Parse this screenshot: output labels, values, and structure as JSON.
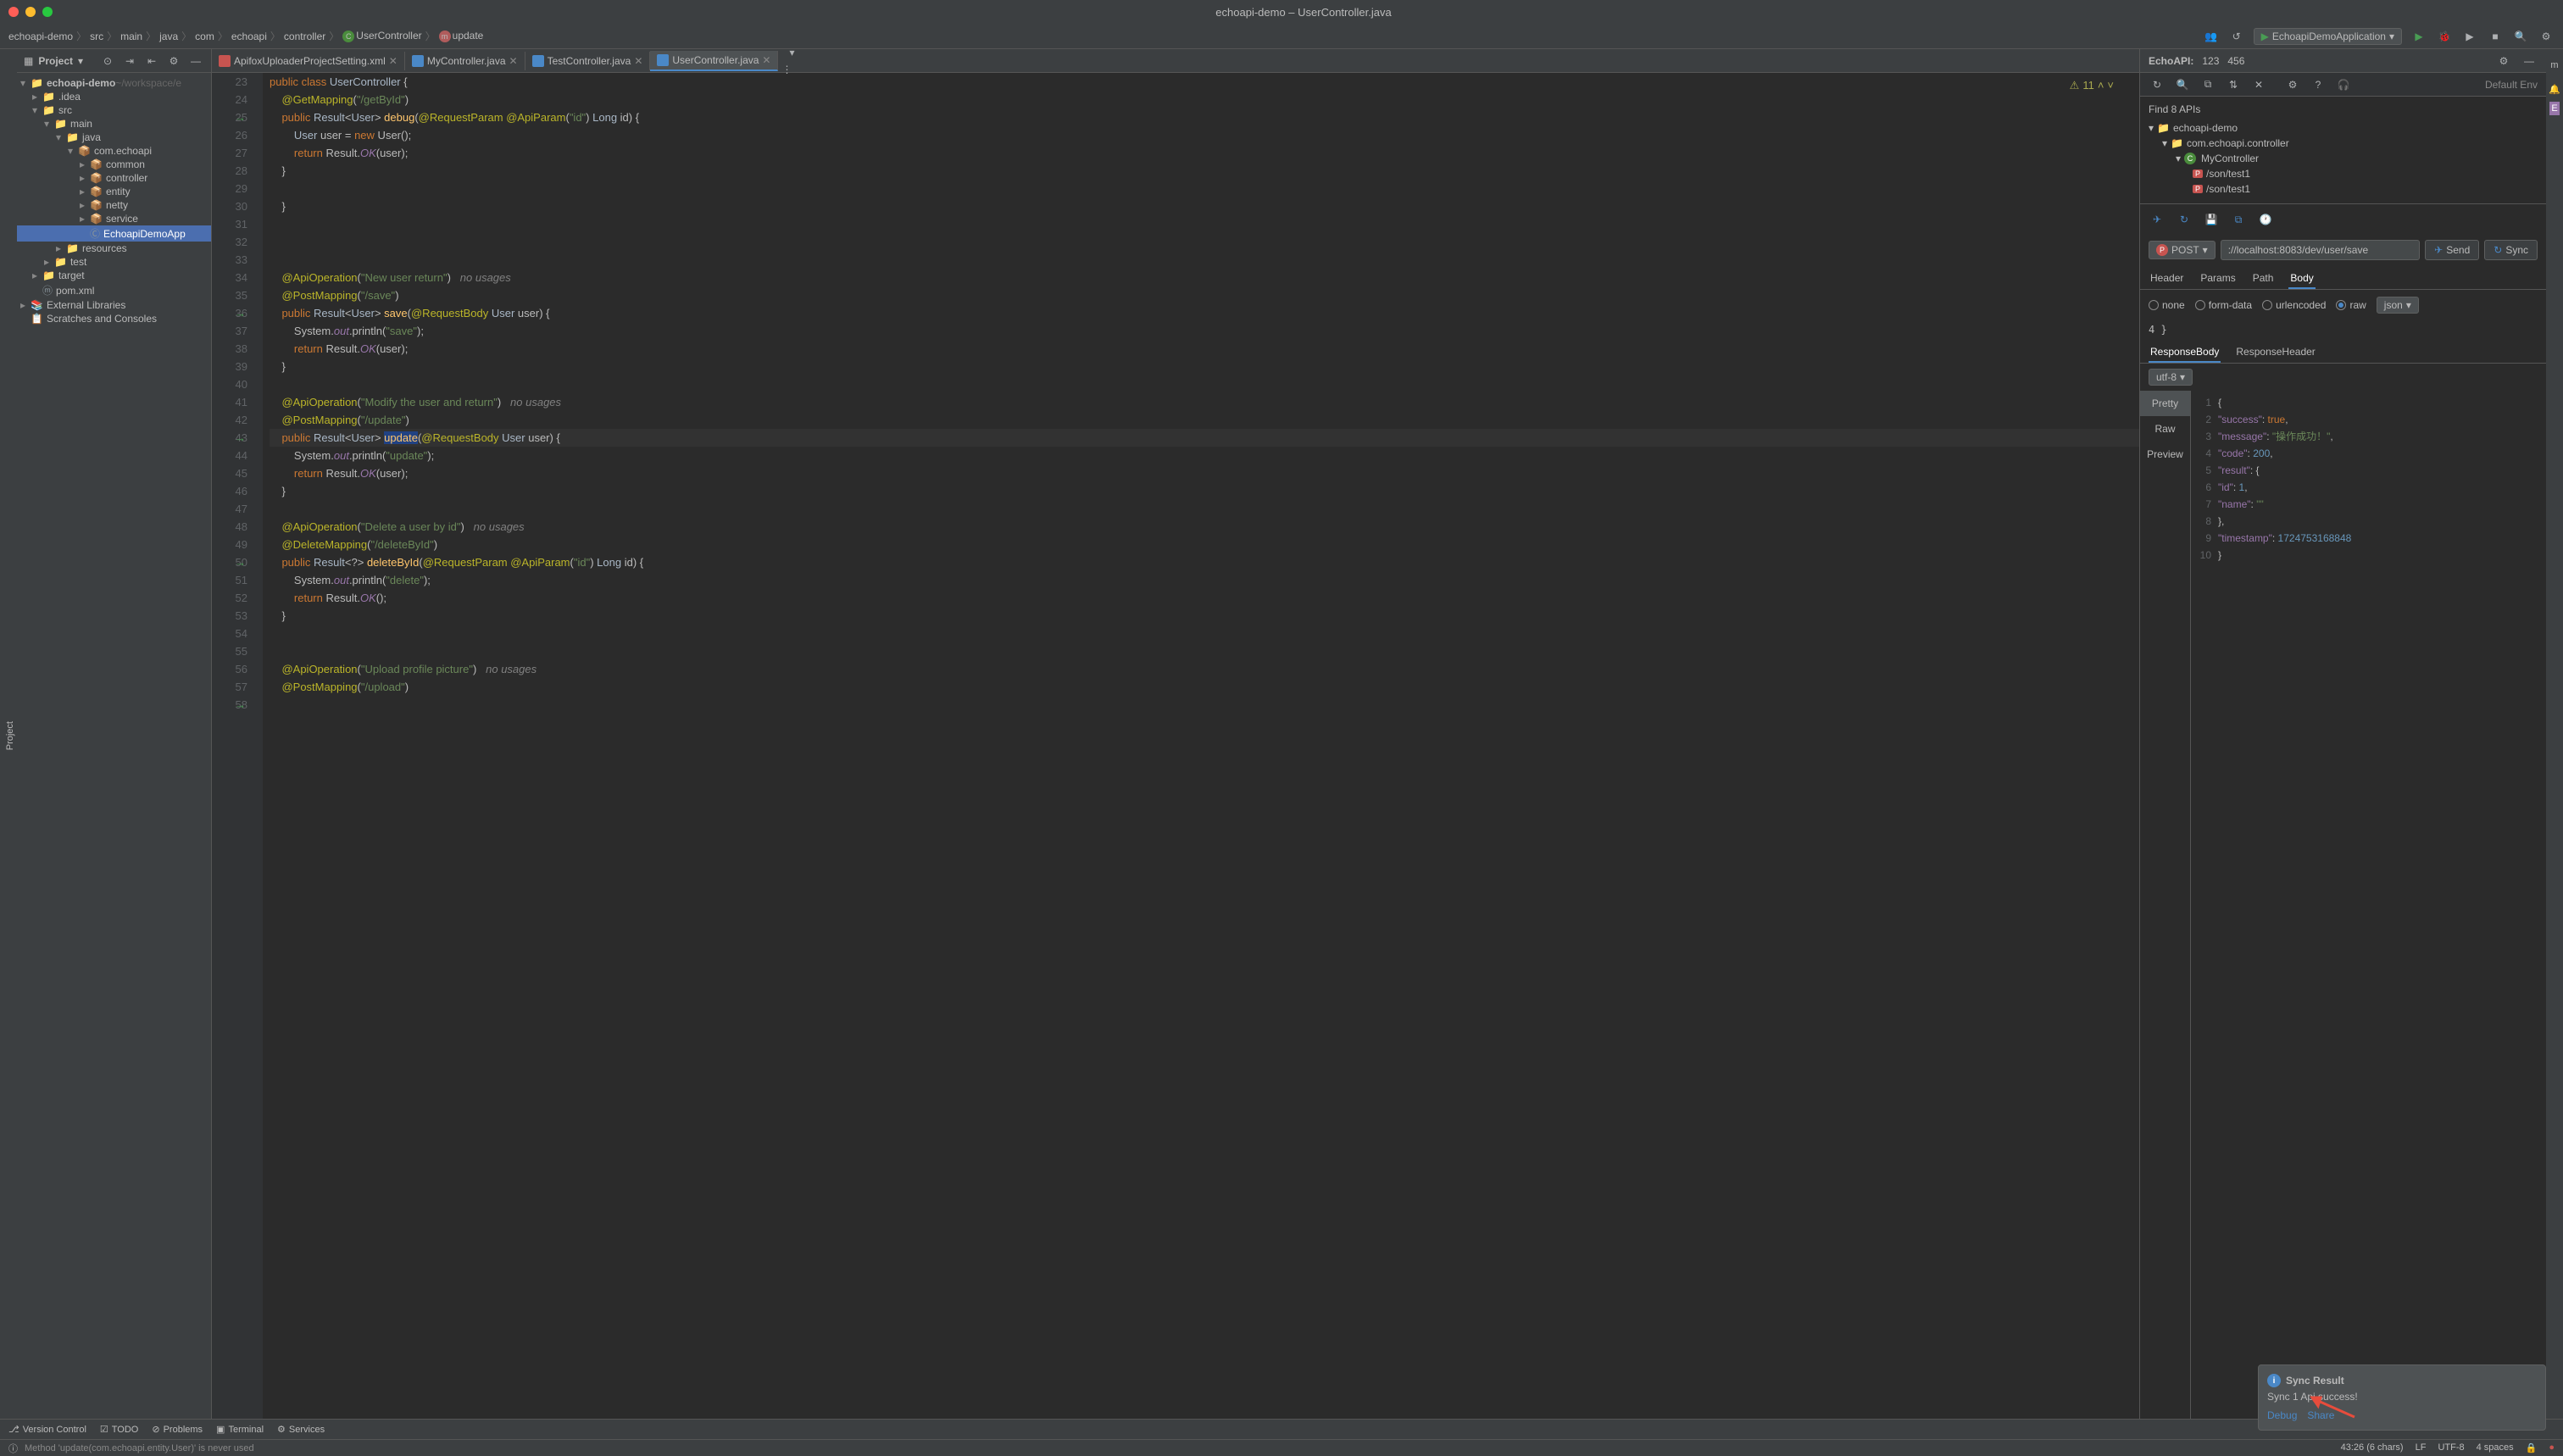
{
  "window": {
    "title": "echoapi-demo – UserController.java"
  },
  "breadcrumb": [
    "echoapi-demo",
    "src",
    "main",
    "java",
    "com",
    "echoapi",
    "controller",
    "UserController",
    "update"
  ],
  "runConfig": "EchoapiDemoApplication",
  "projectPanel": {
    "title": "Project",
    "rootName": "echoapi-demo",
    "rootPath": "~/workspace/e",
    "tree": [
      {
        "indent": 0,
        "arrow": "▾",
        "icon": "📁",
        "name": "echoapi-demo",
        "suffix": " ~/workspace/e",
        "bold": true
      },
      {
        "indent": 1,
        "arrow": "▸",
        "icon": "📁",
        "name": ".idea"
      },
      {
        "indent": 1,
        "arrow": "▾",
        "icon": "📁",
        "name": "src"
      },
      {
        "indent": 2,
        "arrow": "▾",
        "icon": "📁",
        "name": "main"
      },
      {
        "indent": 3,
        "arrow": "▾",
        "icon": "📁",
        "name": "java",
        "blue": true
      },
      {
        "indent": 4,
        "arrow": "▾",
        "icon": "📦",
        "name": "com.echoapi"
      },
      {
        "indent": 5,
        "arrow": "▸",
        "icon": "📦",
        "name": "common"
      },
      {
        "indent": 5,
        "arrow": "▸",
        "icon": "📦",
        "name": "controller"
      },
      {
        "indent": 5,
        "arrow": "▸",
        "icon": "📦",
        "name": "entity"
      },
      {
        "indent": 5,
        "arrow": "▸",
        "icon": "📦",
        "name": "netty"
      },
      {
        "indent": 5,
        "arrow": "▸",
        "icon": "📦",
        "name": "service"
      },
      {
        "indent": 5,
        "arrow": " ",
        "icon": "Ⓒ",
        "name": "EchoapiDemoApp",
        "selected": true
      },
      {
        "indent": 3,
        "arrow": "▸",
        "icon": "📁",
        "name": "resources"
      },
      {
        "indent": 2,
        "arrow": "▸",
        "icon": "📁",
        "name": "test"
      },
      {
        "indent": 1,
        "arrow": "▸",
        "icon": "📁",
        "name": "target"
      },
      {
        "indent": 1,
        "arrow": " ",
        "icon": "ⓜ",
        "name": "pom.xml"
      },
      {
        "indent": 0,
        "arrow": "▸",
        "icon": "📚",
        "name": "External Libraries"
      },
      {
        "indent": 0,
        "arrow": " ",
        "icon": "📋",
        "name": "Scratches and Consoles"
      }
    ]
  },
  "editorTabs": [
    {
      "name": "ApifoxUploaderProjectSetting.xml",
      "icon": "xml"
    },
    {
      "name": "MyController.java",
      "icon": "class"
    },
    {
      "name": "TestController.java",
      "icon": "class"
    },
    {
      "name": "UserController.java",
      "icon": "class",
      "active": true
    }
  ],
  "warningCount": "11",
  "code": {
    "lines": [
      {
        "n": 23,
        "html": "<span class='kw'>public class</span> <span class='type'>UserController</span> {"
      },
      {
        "n": 24,
        "html": "    <span class='anno'>@GetMapping</span>(<span class='str'>\"/getById\"</span>)"
      },
      {
        "n": 25,
        "marker": "→",
        "html": "    <span class='kw'>public</span> <span class='type'>Result</span>&lt;<span class='type'>User</span>&gt; <span class='method'>debug</span>(<span class='anno'>@RequestParam @ApiParam</span>(<span class='str'>\"id\"</span>) <span class='type'>Long</span> id) {"
      },
      {
        "n": 26,
        "html": "        <span class='type'>User</span> user = <span class='kw'>new</span> User();"
      },
      {
        "n": 27,
        "html": "        <span class='kw'>return</span> Result.<span class='field'>OK</span>(user);"
      },
      {
        "n": 28,
        "html": "    }"
      },
      {
        "n": 29,
        "html": ""
      },
      {
        "n": 30,
        "html": "    }"
      },
      {
        "n": 31,
        "html": ""
      },
      {
        "n": 32,
        "html": ""
      },
      {
        "n": 33,
        "html": ""
      },
      {
        "n": 34,
        "html": "    <span class='anno'>@ApiOperation</span>(<span class='str'>\"New user return\"</span>)   <span class='comment'>no usages</span>"
      },
      {
        "n": 35,
        "html": "    <span class='anno'>@PostMapping</span>(<span class='str'>\"/save\"</span>)"
      },
      {
        "n": 36,
        "marker": "→",
        "html": "    <span class='kw'>public</span> <span class='type'>Result</span>&lt;<span class='type'>User</span>&gt; <span class='method'>save</span>(<span class='anno'>@RequestBody</span> <span class='type'>User</span> user) {"
      },
      {
        "n": 37,
        "html": "        System.<span class='field'>out</span>.println(<span class='str'>\"save\"</span>);"
      },
      {
        "n": 38,
        "html": "        <span class='kw'>return</span> Result.<span class='field'>OK</span>(user);"
      },
      {
        "n": 39,
        "html": "    }"
      },
      {
        "n": 40,
        "html": ""
      },
      {
        "n": 41,
        "html": "    <span class='anno'>@ApiOperation</span>(<span class='str'>\"Modify the user and return\"</span>)   <span class='comment'>no usages</span>"
      },
      {
        "n": 42,
        "html": "    <span class='anno'>@PostMapping</span>(<span class='str'>\"/update\"</span>)"
      },
      {
        "n": 43,
        "marker": "→",
        "hl": true,
        "html": "    <span class='kw'>public</span> <span class='type'>Result</span>&lt;<span class='type'>User</span>&gt; <span class='method selected-text'>update</span>(<span class='anno'>@RequestBody</span> <span class='type'>User</span> user) {"
      },
      {
        "n": 44,
        "html": "        System.<span class='field'>out</span>.println(<span class='str'>\"update\"</span>);"
      },
      {
        "n": 45,
        "html": "        <span class='kw'>return</span> Result.<span class='field'>OK</span>(user);"
      },
      {
        "n": 46,
        "html": "    }"
      },
      {
        "n": 47,
        "html": ""
      },
      {
        "n": 48,
        "html": "    <span class='anno'>@ApiOperation</span>(<span class='str'>\"Delete a user by id\"</span>)   <span class='comment'>no usages</span>"
      },
      {
        "n": 49,
        "html": "    <span class='anno'>@DeleteMapping</span>(<span class='str'>\"/deleteById\"</span>)"
      },
      {
        "n": 50,
        "marker": "→",
        "html": "    <span class='kw'>public</span> <span class='type'>Result</span>&lt;?&gt; <span class='method'>deleteById</span>(<span class='anno'>@RequestParam @ApiParam</span>(<span class='str'>\"id\"</span>) <span class='type'>Long</span> id) {"
      },
      {
        "n": 51,
        "html": "        System.<span class='field'>out</span>.println(<span class='str'>\"delete\"</span>);"
      },
      {
        "n": 52,
        "html": "        <span class='kw'>return</span> Result.<span class='field'>OK</span>();"
      },
      {
        "n": 53,
        "html": "    }"
      },
      {
        "n": 54,
        "html": ""
      },
      {
        "n": 55,
        "html": ""
      },
      {
        "n": 56,
        "html": "    <span class='anno'>@ApiOperation</span>(<span class='str'>\"Upload profile picture\"</span>)   <span class='comment'>no usages</span>"
      },
      {
        "n": 57,
        "html": "    <span class='anno'>@PostMapping</span>(<span class='str'>\"/upload\"</span>)"
      },
      {
        "n": 58,
        "marker": "→",
        "html": ""
      }
    ]
  },
  "echoPanel": {
    "title": "EchoAPI:",
    "stat1": "123",
    "stat2": "456",
    "env": "Default Env",
    "apiTreeTitle": "Find 8 APIs",
    "apiTree": [
      {
        "indent": 0,
        "arrow": "▾",
        "name": "echoapi-demo"
      },
      {
        "indent": 1,
        "arrow": "▾",
        "name": "com.echoapi.controller"
      },
      {
        "indent": 2,
        "arrow": "▾",
        "name": "MyController",
        "icon": "C"
      },
      {
        "indent": 3,
        "arrow": " ",
        "name": "/son/test1",
        "badge": "P"
      },
      {
        "indent": 3,
        "arrow": " ",
        "name": "/son/test1",
        "badge": "P"
      }
    ],
    "method": "POST",
    "url": "://localhost:8083/dev/user/save",
    "sendLabel": "Send",
    "syncLabel": "Sync",
    "reqTabs": [
      "Header",
      "Params",
      "Path",
      "Body"
    ],
    "activeReqTab": 3,
    "bodyTypes": [
      "none",
      "form-data",
      "urlencoded",
      "raw"
    ],
    "bodyTypeSelected": 3,
    "bodyFormat": "json",
    "bodyContent": "4   }",
    "respTabs": [
      "ResponseBody",
      "ResponseHeader"
    ],
    "activeRespTab": 0,
    "encoding": "utf-8",
    "respViewTabs": [
      "Pretty",
      "Raw",
      "Preview"
    ],
    "respJson": [
      {
        "n": 1,
        "html": "{"
      },
      {
        "n": 2,
        "html": "  <span class='json-key'>\"success\"</span>: <span class='json-bool'>true</span>,"
      },
      {
        "n": 3,
        "html": "  <span class='json-key'>\"message\"</span>: <span class='json-str'>\"操作成功！\"</span>,"
      },
      {
        "n": 4,
        "html": "  <span class='json-key'>\"code\"</span>: <span class='json-num'>200</span>,"
      },
      {
        "n": 5,
        "html": "  <span class='json-key'>\"result\"</span>: {"
      },
      {
        "n": 6,
        "html": "    <span class='json-key'>\"id\"</span>: <span class='json-num'>1</span>,"
      },
      {
        "n": 7,
        "html": "    <span class='json-key'>\"name\"</span>: <span class='json-str'>\"\"</span>"
      },
      {
        "n": 8,
        "html": "  },"
      },
      {
        "n": 9,
        "html": "  <span class='json-key'>\"timestamp\"</span>: <span class='json-num'>1724753168848</span>"
      },
      {
        "n": 10,
        "html": "}"
      }
    ]
  },
  "notification": {
    "title": "Sync Result",
    "message": "Sync 1 Api success!",
    "actions": [
      "Debug",
      "Share"
    ]
  },
  "bottomBar": {
    "items": [
      "Version Control",
      "TODO",
      "Problems",
      "Terminal",
      "Services"
    ]
  },
  "statusBar": {
    "message": "Method 'update(com.echoapi.entity.User)' is never used",
    "position": "43:26 (6 chars)",
    "lineEnd": "LF",
    "encoding": "UTF-8",
    "indent": "4 spaces"
  }
}
